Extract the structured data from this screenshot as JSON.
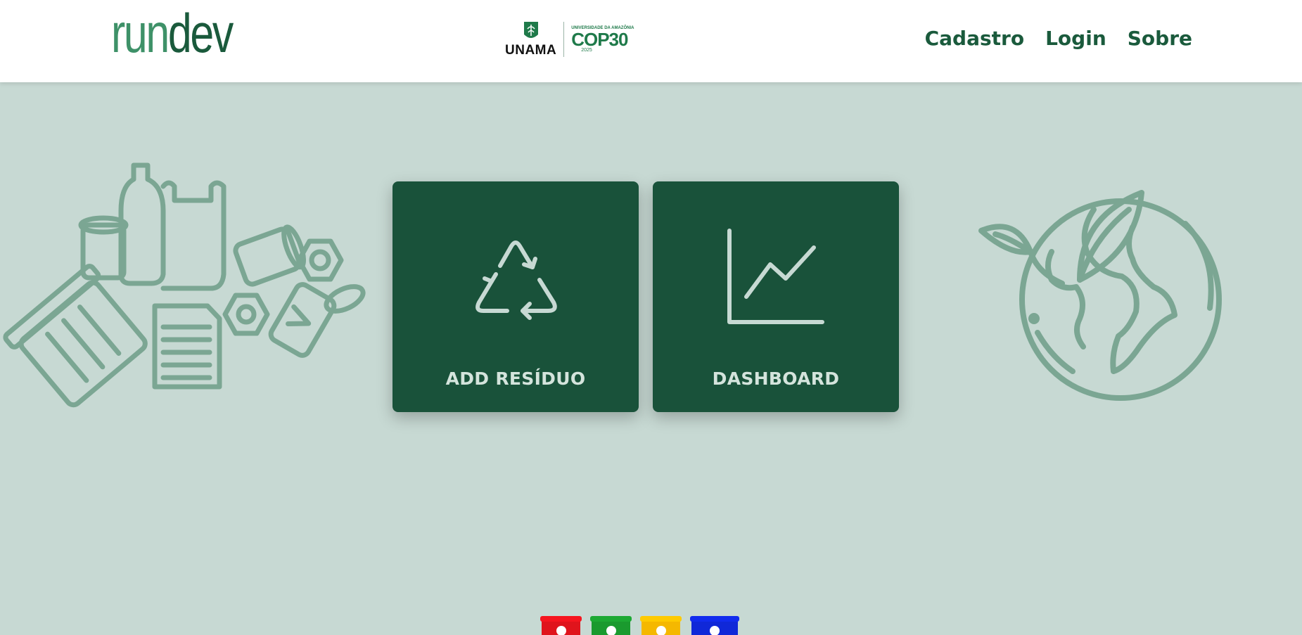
{
  "brand": {
    "part1": "run",
    "part2": "dev"
  },
  "partners": {
    "unama": "UNAMA",
    "cop_university": "UNIVERSIDADE DA AMAZÔNIA",
    "cop_title": "COP30",
    "cop_year": "2025"
  },
  "nav": {
    "items": [
      "Cadastro",
      "Login",
      "Sobre"
    ]
  },
  "cards": [
    {
      "label": "ADD RESÍDUO",
      "icon": "recycle-icon"
    },
    {
      "label": "DASHBOARD",
      "icon": "line-chart-icon"
    }
  ],
  "decorations": {
    "left": "waste-items-illustration",
    "right": "earth-with-leaves-illustration",
    "bottom": "recycling-bins-illustration"
  },
  "bins": {
    "colors": [
      "#e0141c",
      "#1a9a2e",
      "#f5b800",
      "#1028d8"
    ]
  },
  "colors": {
    "background": "#c7d9d3",
    "card": "#19523a",
    "accent": "#1a5a3c",
    "illustration": "#7ba693"
  }
}
